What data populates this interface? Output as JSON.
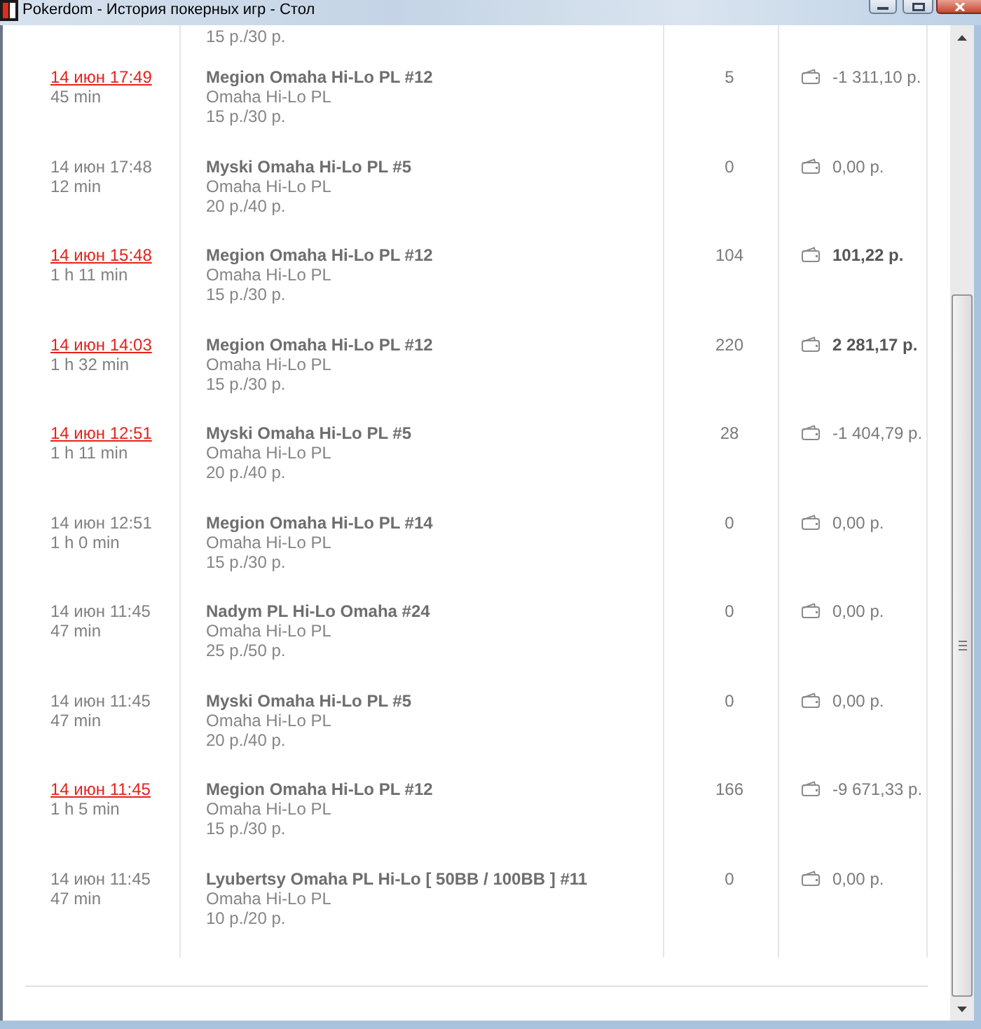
{
  "window": {
    "title": "Pokerdom - История покерных игр - Стол"
  },
  "partial_row": {
    "stakes": "15 р./30 р."
  },
  "rows": [
    {
      "date": "14 июн 17:49",
      "linked": true,
      "duration": "45 min",
      "table": "Megion Omaha Hi-Lo PL #12",
      "game": "Omaha Hi-Lo PL",
      "stakes": "15 р./30 р.",
      "hands": "5",
      "result": "-1 311,10 р.",
      "kind": "loss"
    },
    {
      "date": "14 июн 17:48",
      "linked": false,
      "duration": "12 min",
      "table": "Myski Omaha Hi-Lo PL #5",
      "game": "Omaha Hi-Lo PL",
      "stakes": "20 р./40 р.",
      "hands": "0",
      "result": "0,00 р.",
      "kind": "even"
    },
    {
      "date": "14 июн 15:48",
      "linked": true,
      "duration": "1 h 11 min",
      "table": "Megion Omaha Hi-Lo PL #12",
      "game": "Omaha Hi-Lo PL",
      "stakes": "15 р./30 р.",
      "hands": "104",
      "result": "101,22 р.",
      "kind": "win"
    },
    {
      "date": "14 июн 14:03",
      "linked": true,
      "duration": "1 h 32 min",
      "table": "Megion Omaha Hi-Lo PL #12",
      "game": "Omaha Hi-Lo PL",
      "stakes": "15 р./30 р.",
      "hands": "220",
      "result": "2 281,17 р.",
      "kind": "win"
    },
    {
      "date": "14 июн 12:51",
      "linked": true,
      "duration": "1 h 11 min",
      "table": "Myski Omaha Hi-Lo PL #5",
      "game": "Omaha Hi-Lo PL",
      "stakes": "20 р./40 р.",
      "hands": "28",
      "result": "-1 404,79 р.",
      "kind": "loss"
    },
    {
      "date": "14 июн 12:51",
      "linked": false,
      "duration": "1 h 0 min",
      "table": "Megion Omaha Hi-Lo PL #14",
      "game": "Omaha Hi-Lo PL",
      "stakes": "15 р./30 р.",
      "hands": "0",
      "result": "0,00 р.",
      "kind": "even"
    },
    {
      "date": "14 июн 11:45",
      "linked": false,
      "duration": "47 min",
      "table": "Nadym PL Hi-Lo Omaha #24",
      "game": "Omaha Hi-Lo PL",
      "stakes": "25 р./50 р.",
      "hands": "0",
      "result": "0,00 р.",
      "kind": "even"
    },
    {
      "date": "14 июн 11:45",
      "linked": false,
      "duration": "47 min",
      "table": "Myski Omaha Hi-Lo PL #5",
      "game": "Omaha Hi-Lo PL",
      "stakes": "20 р./40 р.",
      "hands": "0",
      "result": "0,00 р.",
      "kind": "even"
    },
    {
      "date": "14 июн 11:45",
      "linked": true,
      "duration": "1 h 5 min",
      "table": "Megion Omaha Hi-Lo PL #12",
      "game": "Omaha Hi-Lo PL",
      "stakes": "15 р./30 р.",
      "hands": "166",
      "result": "-9 671,33 р.",
      "kind": "loss"
    },
    {
      "date": "14 июн 11:45",
      "linked": false,
      "duration": "47 min",
      "table": "Lyubertsy Omaha PL Hi-Lo [ 50BB / 100BB ] #11",
      "game": "Omaha Hi-Lo PL",
      "stakes": "10 р./20 р.",
      "hands": "0",
      "result": "0,00 р.",
      "kind": "even"
    }
  ]
}
